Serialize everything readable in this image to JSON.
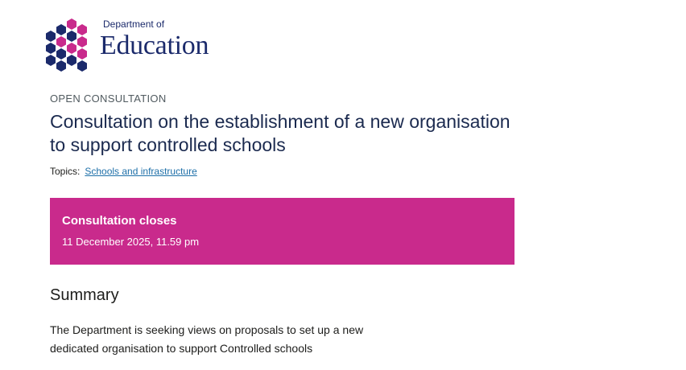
{
  "logo": {
    "small_text": "Department of",
    "big_text": "Education"
  },
  "page": {
    "eyebrow": "OPEN CONSULTATION",
    "title": "Consultation on the establishment of a new organisation to support controlled schools",
    "topics_label": "Topics:",
    "topic_link": "Schools and infrastructure"
  },
  "closing_banner": {
    "heading": "Consultation closes",
    "date": "11 December 2025, 11.59 pm",
    "color": "#c92a8c"
  },
  "summary": {
    "heading": "Summary",
    "text": "The Department is seeking views on proposals to set up a new dedicated organisation to support Controlled schools"
  },
  "colors": {
    "navy": "#1b2a6b",
    "magenta": "#c92a8c",
    "link": "#1d6fa8"
  }
}
